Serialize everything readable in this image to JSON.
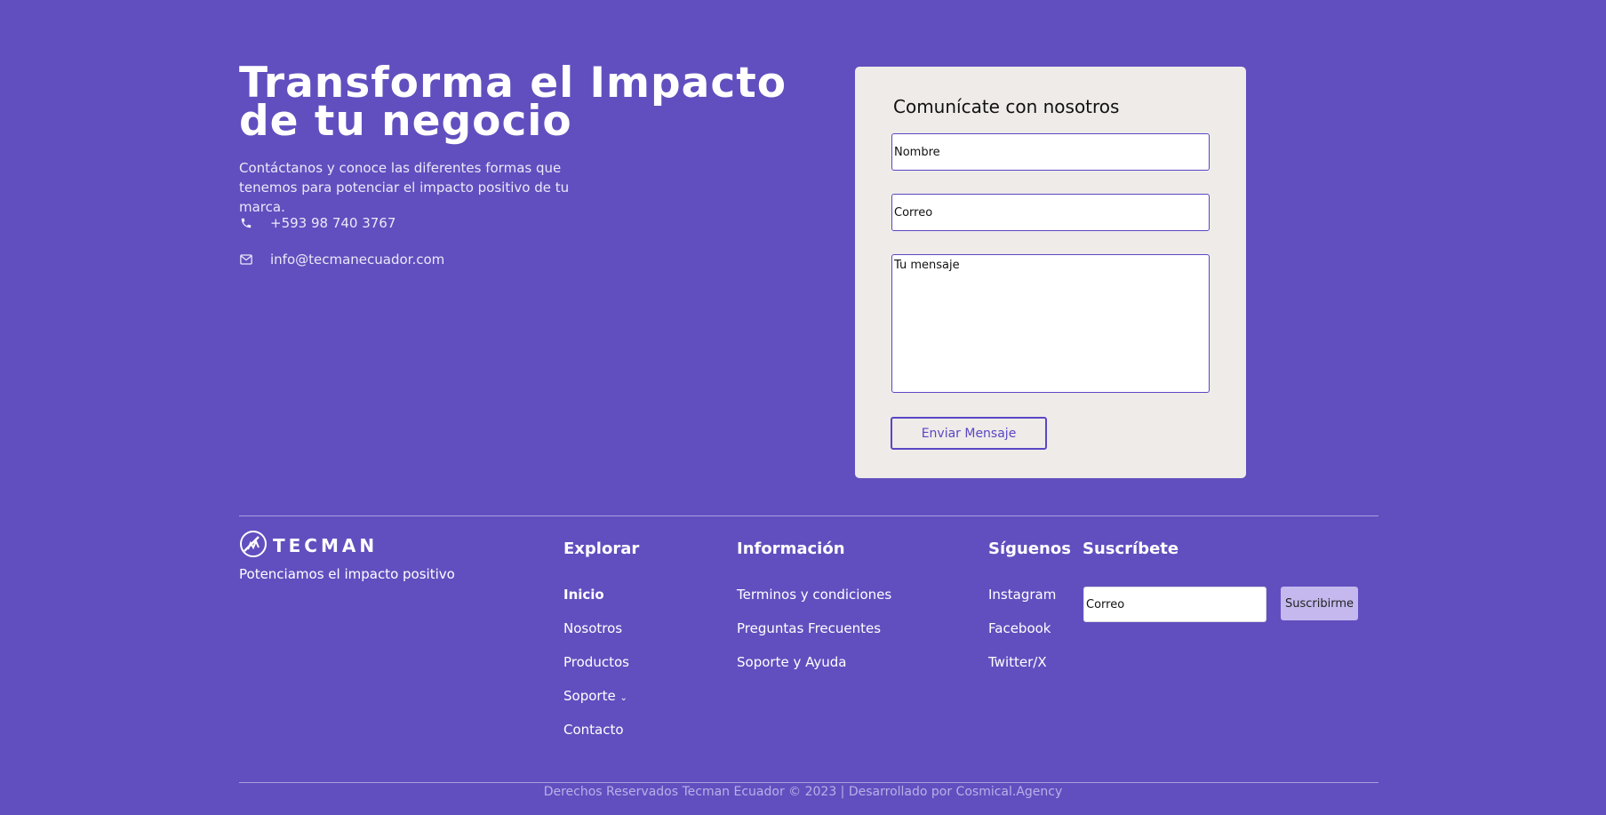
{
  "hero": {
    "title_line1": "Transforma el Impacto",
    "title_line2": "de tu negocio",
    "description": "Contáctanos y conoce las diferentes formas que tenemos para potenciar el impacto positivo de tu marca.",
    "phone": "+593 98 740 3767",
    "email": "info@tecmanecuador.com",
    "phone_icon": "phone-icon",
    "email_icon": "envelope-icon"
  },
  "form": {
    "title": "Comunícate con nosotros",
    "name_placeholder": "Nombre",
    "email_placeholder": "Correo",
    "message_placeholder": "Tu mensaje",
    "submit_label": "Enviar Mensaje"
  },
  "footer": {
    "brand_name": "TECMAN",
    "tagline": "Potenciamos el impacto positivo",
    "explore": {
      "title": "Explorar",
      "links": [
        "Inicio",
        "Nosotros",
        "Productos",
        "Soporte",
        "Contacto"
      ]
    },
    "info": {
      "title": "Información",
      "links": [
        "Terminos y condiciones",
        "Preguntas Frecuentes",
        "Soporte y Ayuda"
      ]
    },
    "social": {
      "title": "Síguenos",
      "links": [
        "Instagram",
        "Facebook",
        "Twitter/X"
      ]
    },
    "subscribe": {
      "title": "Suscríbete",
      "placeholder": "Correo",
      "button_label": "Suscribirme"
    },
    "copyright": "Derechos Reservados Tecman Ecuador © 2023 | Desarrollado por Cosmical.Agency"
  },
  "colors": {
    "background": "#614fbf",
    "card": "#efebe9",
    "accent": "#5a47c4",
    "subscribe_button": "#c5b8ee"
  }
}
